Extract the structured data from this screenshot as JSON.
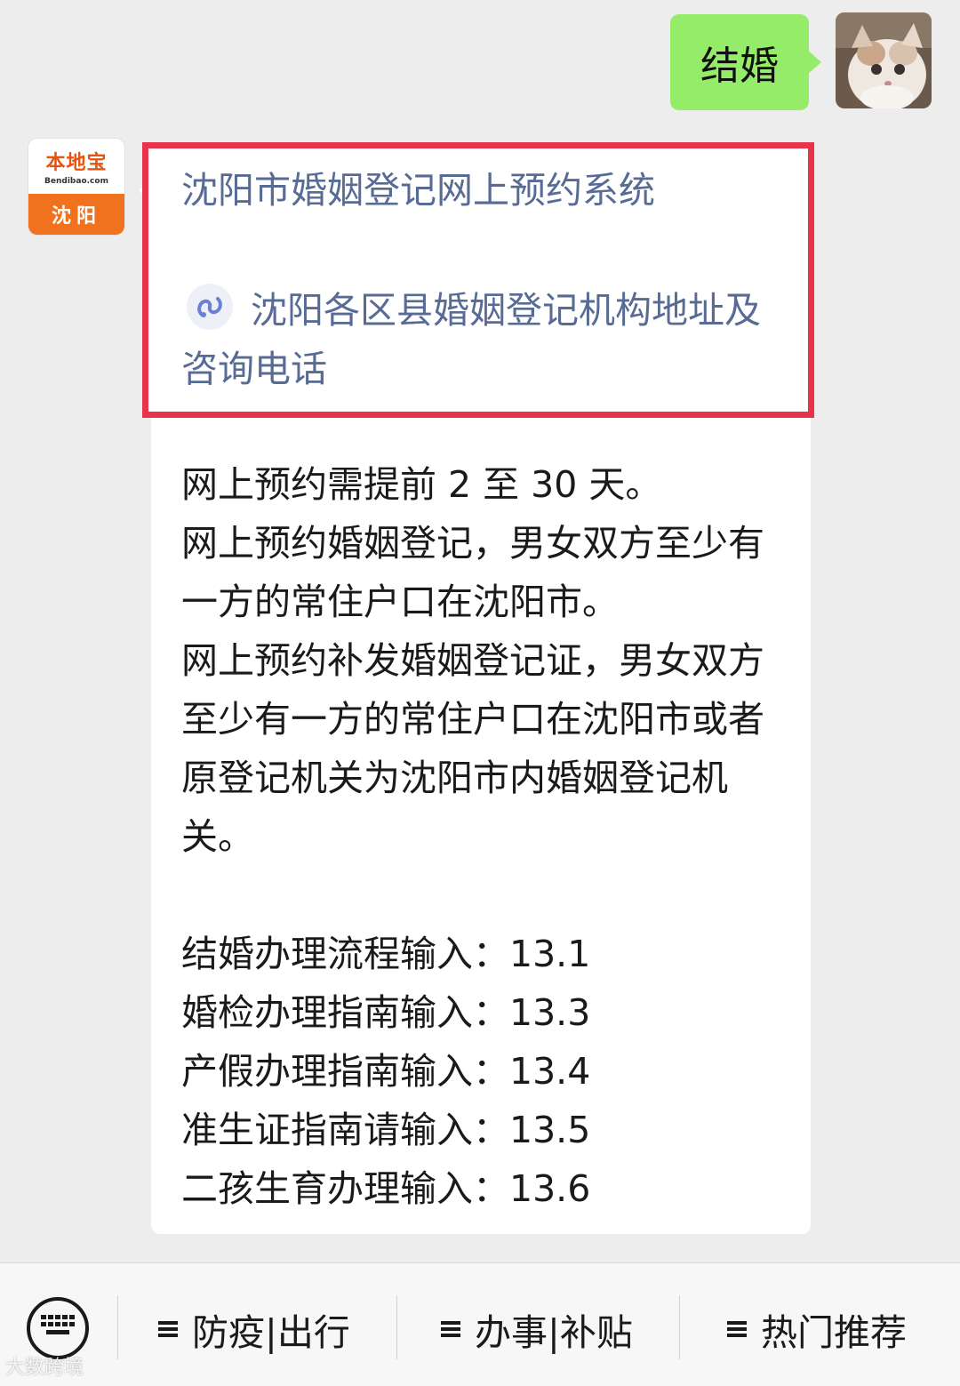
{
  "outgoing": {
    "text": "结婚"
  },
  "bot_avatar": {
    "brand": "本地宝",
    "domain": "Bendibao.com",
    "city": "沈阳"
  },
  "reply": {
    "link_title": "沈阳市婚姻登记网上预约系统",
    "mini_program_link": "沈阳各区县婚姻登记机构地址及咨询电话",
    "paragraphs": [
      "网上预约需提前 2 至 30 天。",
      "网上预约婚姻登记，男女双方至少有一方的常住户口在沈阳市。",
      "网上预约补发婚姻登记证，男女双方至少有一方的常住户口在沈阳市或者原登记机关为沈阳市内婚姻登记机关。"
    ],
    "guides": [
      "结婚办理流程输入：13.1",
      "婚检办理指南输入：13.3",
      "产假办理指南输入：13.4",
      "准生证指南请输入：13.5",
      "二孩生育办理输入：13.6"
    ]
  },
  "menu": {
    "items": [
      "防疫|出行",
      "办事|补贴",
      "热门推荐"
    ]
  },
  "watermark": "大数跨境",
  "colors": {
    "outgoing_bubble": "#95ec69",
    "link_text": "#576b95",
    "highlight_border": "#e8344a",
    "brand_orange": "#f0721f"
  }
}
